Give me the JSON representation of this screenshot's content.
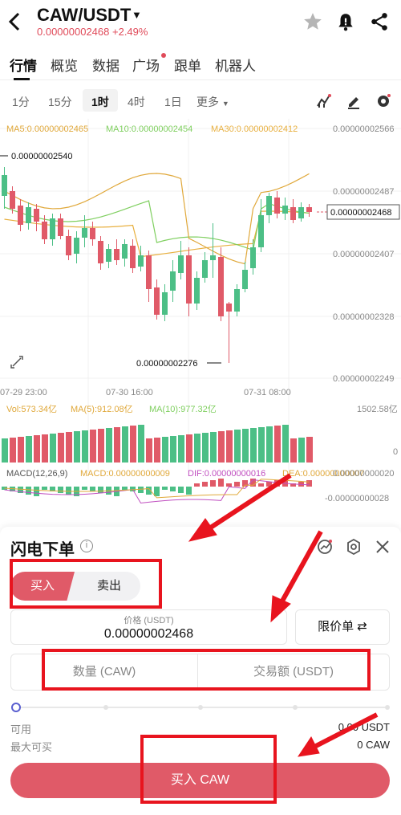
{
  "header": {
    "back_icon": "chevron-left-icon",
    "pair": "CAW/USDT",
    "price": "0.00000002468",
    "change": "+2.49%",
    "icons": [
      "star-icon",
      "bell-icon",
      "share-icon"
    ]
  },
  "tabs": [
    {
      "label": "行情",
      "active": true
    },
    {
      "label": "概览"
    },
    {
      "label": "数据"
    },
    {
      "label": "广场",
      "dot": true
    },
    {
      "label": "跟单"
    },
    {
      "label": "机器人"
    }
  ],
  "intervals": {
    "items": [
      "1分",
      "15分",
      "1时",
      "4时",
      "1日",
      "更多"
    ],
    "active": "1时",
    "tool_icons": [
      "indicator-icon",
      "draw-pen-icon",
      "settings-icon"
    ]
  },
  "chart": {
    "ma_legend": {
      "ma5": "MA5:0.00000002465",
      "ma10": "MA10:0.00000002454",
      "ma30": "MA30:0.00000002412"
    },
    "y_ticks": [
      "0.00000002566",
      "0.00000002487",
      "0.00000002407",
      "0.00000002328",
      "0.00000002249"
    ],
    "high_label": "0.00000002540",
    "low_label": "0.00000002276",
    "current_price_tag": "0.00000002468",
    "x_ticks": [
      "07-29 23:00",
      "07-30 16:00",
      "07-31 08:00"
    ],
    "volume": {
      "vol": "Vol:573.34亿",
      "ma5": "MA(5):912.08亿",
      "ma10": "MA(10):977.32亿",
      "max": "1502.58亿",
      "zero": "0"
    },
    "macd": {
      "label": "MACD(12,26,9)",
      "macd": "MACD:0.00000000009",
      "dif": "DIF:0.00000000016",
      "dea": "DEA:0.00000000007",
      "top": "0.00000000020",
      "bottom": "-0.00000000028"
    },
    "colors": {
      "up": "#4cbf86",
      "down": "#e05a68"
    }
  },
  "panel": {
    "title": "闪电下单",
    "info_icon": "info-icon",
    "icons": [
      "pnl-chart-icon",
      "gear-icon",
      "close-icon"
    ],
    "buy_label": "买入",
    "sell_label": "卖出",
    "price_label": "价格 (USDT)",
    "price_value": "0.00000002468",
    "order_type": "限价单 ⇄",
    "qty_placeholder": "数量 (CAW)",
    "turnover_placeholder": "交易额 (USDT)",
    "slider_percent": 0,
    "available_label": "可用",
    "available_value": "0.00 USDT",
    "max_buy_label": "最大可买",
    "max_buy_value": "0 CAW",
    "submit_label": "买入 CAW"
  }
}
